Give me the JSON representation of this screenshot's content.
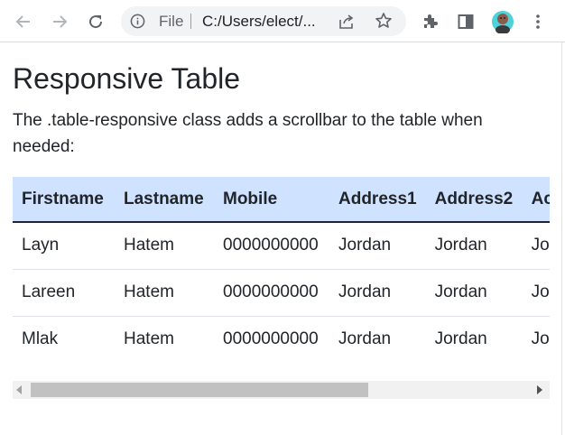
{
  "browser": {
    "omnibox": {
      "file_label": "File",
      "url": "C:/Users/elect/..."
    },
    "icons": [
      "back-icon",
      "forward-icon",
      "reload-icon",
      "info-icon",
      "share-icon",
      "star-icon",
      "extensions-icon",
      "sidebar-icon",
      "profile-avatar",
      "menu-icon"
    ]
  },
  "page": {
    "heading": "Responsive Table",
    "description": "The .table-responsive class adds a scrollbar to the table when needed:"
  },
  "table": {
    "headers": [
      "Firstname",
      "Lastname",
      "Mobile",
      "Address1",
      "Address2",
      "Ac"
    ],
    "rows": [
      [
        "Layn",
        "Hatem",
        "0000000000",
        "Jordan",
        "Jordan",
        "Jor"
      ],
      [
        "Lareen",
        "Hatem",
        "0000000000",
        "Jordan",
        "Jordan",
        "Jor"
      ],
      [
        "Mlak",
        "Hatem",
        "0000000000",
        "Jordan",
        "Jordan",
        "Jor"
      ]
    ]
  },
  "colors": {
    "header_bg": "#cfe2ff",
    "text": "#212529",
    "toolbar_icon": "#5f6368"
  }
}
